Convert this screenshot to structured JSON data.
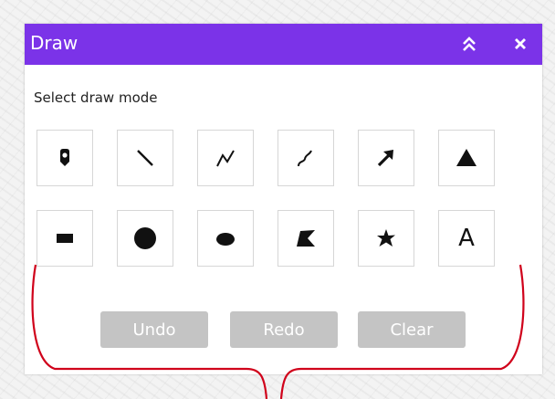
{
  "panel": {
    "title": "Draw",
    "collapse_icon": "double-chevron-up-icon",
    "close_icon": "close-icon",
    "titlebar_color": "#7b33e8"
  },
  "mode_label": "Select draw mode",
  "tools": [
    {
      "name": "point",
      "icon": "map-pin-icon"
    },
    {
      "name": "line",
      "icon": "line-icon"
    },
    {
      "name": "polyline",
      "icon": "polyline-icon"
    },
    {
      "name": "freehand-polyline",
      "icon": "freehand-line-icon"
    },
    {
      "name": "arrow",
      "icon": "arrow-icon"
    },
    {
      "name": "triangle",
      "icon": "triangle-icon"
    },
    {
      "name": "rectangle",
      "icon": "rectangle-icon"
    },
    {
      "name": "circle",
      "icon": "circle-icon"
    },
    {
      "name": "ellipse",
      "icon": "ellipse-icon"
    },
    {
      "name": "polygon",
      "icon": "polygon-icon"
    },
    {
      "name": "freehand-polygon",
      "icon": "freehand-polygon-icon"
    },
    {
      "name": "text",
      "icon": "text-icon",
      "label": "A"
    }
  ],
  "actions": {
    "undo": "Undo",
    "redo": "Redo",
    "clear": "Clear",
    "disabled_color": "#c4c4c4"
  },
  "annotation_color": "#d0021b"
}
